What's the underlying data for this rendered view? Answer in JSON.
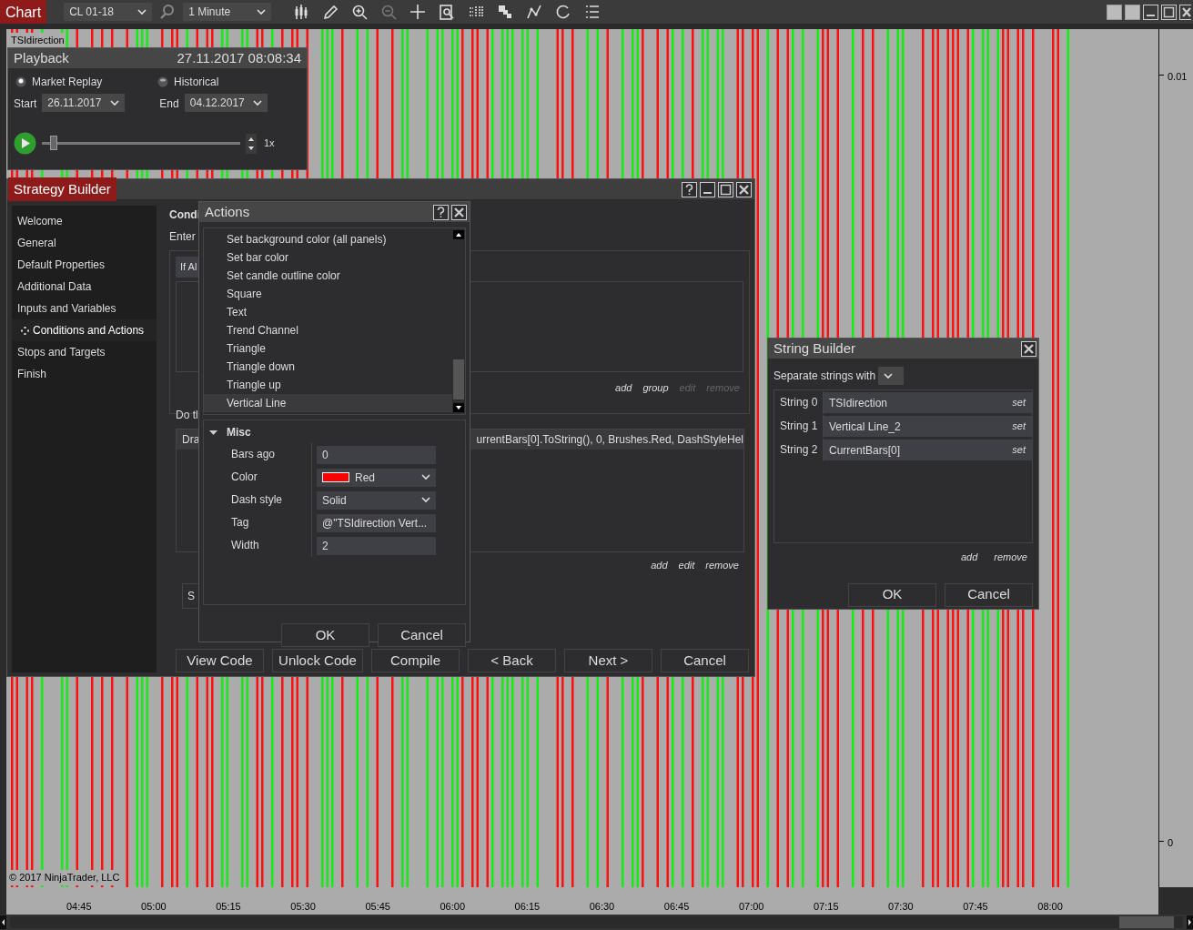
{
  "toolbar": {
    "tab": "Chart",
    "instrument": "CL 01-18",
    "interval": "1 Minute"
  },
  "chart": {
    "indicator_label": "TSIdirection",
    "price_labels": [
      "0.01",
      "0"
    ],
    "time_labels": [
      "04:45",
      "05:00",
      "05:15",
      "05:30",
      "05:45",
      "06:00",
      "06:15",
      "06:30",
      "06:45",
      "07:00",
      "07:15",
      "07:30",
      "07:45",
      "08:00"
    ],
    "copyright": "© 2017 NinjaTrader, LLC"
  },
  "playback": {
    "title": "Playback",
    "time": "27.11.2017 08:08:34",
    "modes": [
      {
        "label": "Market Replay",
        "selected": true
      },
      {
        "label": "Historical",
        "selected": false
      }
    ],
    "start_label": "Start",
    "start": "26.11.2017",
    "end_label": "End",
    "end": "04.12.2017",
    "level": 0.04,
    "speed": "1x"
  },
  "strategy_builder": {
    "title": "Strategy Builder",
    "nav": [
      {
        "label": "Welcome",
        "selected": false
      },
      {
        "label": "General",
        "selected": false
      },
      {
        "label": "Default Properties",
        "selected": false
      },
      {
        "label": "Additional Data",
        "selected": false
      },
      {
        "label": "Inputs and Variables",
        "selected": false
      },
      {
        "label": "Conditions and Actions",
        "selected": true
      },
      {
        "label": "Stops and Targets",
        "selected": false
      },
      {
        "label": "Finish",
        "selected": false
      }
    ],
    "heading": "Condi",
    "intro": "Enter",
    "condition_tab": "If Al",
    "condition_links": [
      {
        "label": "add",
        "disabled": false
      },
      {
        "label": "group",
        "disabled": false
      },
      {
        "label": "edit",
        "disabled": true
      },
      {
        "label": "remove",
        "disabled": true
      }
    ],
    "actions_label": "Do tl",
    "action_start": "Dra",
    "action_end": "urrentBars[0].ToString(), 0, Brushes.Red, DashStyleHel",
    "action_links": [
      {
        "label": "add",
        "disabled": false
      },
      {
        "label": "edit",
        "disabled": false
      },
      {
        "label": "remove",
        "disabled": false
      }
    ],
    "set_label": "S",
    "buttons": [
      "View Code",
      "Unlock Code",
      "Compile",
      "< Back",
      "Next >",
      "Cancel"
    ]
  },
  "actions_dialog": {
    "title": "Actions",
    "items": [
      {
        "label": "Set background color (all panels)",
        "selected": false
      },
      {
        "label": "Set bar color",
        "selected": false
      },
      {
        "label": "Set candle outline color",
        "selected": false
      },
      {
        "label": "Square",
        "selected": false
      },
      {
        "label": "Text",
        "selected": false
      },
      {
        "label": "Trend Channel",
        "selected": false
      },
      {
        "label": "Triangle",
        "selected": false
      },
      {
        "label": "Triangle down",
        "selected": false
      },
      {
        "label": "Triangle up",
        "selected": false
      },
      {
        "label": "Vertical Line",
        "selected": true
      }
    ],
    "section": "Misc",
    "expanded": true,
    "properties": [
      {
        "label": "Bars ago",
        "value": "0",
        "kind": "text"
      },
      {
        "label": "Color",
        "value": "Red",
        "kind": "color",
        "color": "#ff0000"
      },
      {
        "label": "Dash style",
        "value": "Solid",
        "kind": "select"
      },
      {
        "label": "Tag",
        "value": "@\"TSIdirection Vert...",
        "kind": "text"
      },
      {
        "label": "Width",
        "value": "2",
        "kind": "text"
      }
    ],
    "buttons": [
      "OK",
      "Cancel"
    ]
  },
  "string_builder": {
    "title": "String Builder",
    "separator_label": "Separate strings with",
    "strings": [
      {
        "label": "String 0",
        "value": "TSIdirection",
        "action": "set"
      },
      {
        "label": "String 1",
        "value": "Vertical Line_2",
        "action": "set"
      },
      {
        "label": "String 2",
        "value": "CurrentBars[0]",
        "action": "set"
      }
    ],
    "links": [
      "add",
      "remove"
    ],
    "buttons": [
      "OK",
      "Cancel"
    ]
  }
}
